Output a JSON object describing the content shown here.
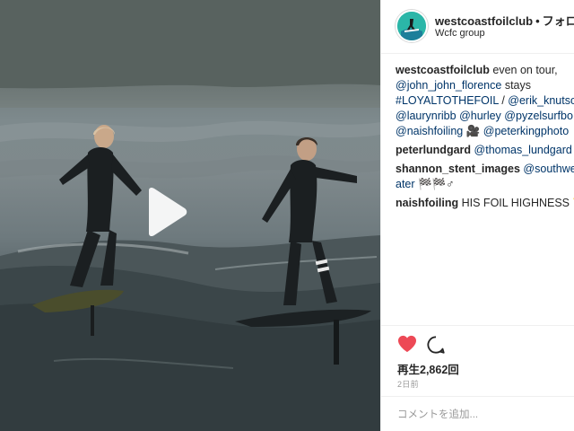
{
  "post": {
    "username": "westcoastfoilclub",
    "separator": "•",
    "follow_label": "フォロー",
    "location": "Wcfc group",
    "views_label": "再生2,862回",
    "timestamp": "2日前",
    "comment_placeholder": "コメントを追加..."
  },
  "comments": [
    {
      "user": "westcoastfoilclub",
      "lines": [
        [
          {
            "t": "text",
            "v": "even on tour,"
          }
        ],
        [
          {
            "t": "mention",
            "v": "@john_john_florence"
          },
          {
            "t": "text",
            "v": " stays"
          }
        ],
        [
          {
            "t": "mention",
            "v": "#LOYALTOTHEFOIL"
          },
          {
            "t": "text",
            "v": " / "
          },
          {
            "t": "mention",
            "v": "@erik_knutson_"
          }
        ],
        [
          {
            "t": "mention",
            "v": "@laurynribb"
          },
          {
            "t": "text",
            "v": " "
          },
          {
            "t": "mention",
            "v": "@hurley"
          },
          {
            "t": "text",
            "v": " "
          },
          {
            "t": "mention",
            "v": "@pyzelsurfbo"
          }
        ],
        [
          {
            "t": "mention",
            "v": "@naishfoiling"
          },
          {
            "t": "text",
            "v": " 🎥 "
          },
          {
            "t": "mention",
            "v": "@peterkingphoto"
          }
        ]
      ]
    },
    {
      "user": "peterlundgard",
      "lines": [
        [
          {
            "t": "mention",
            "v": "@thomas_lundgard"
          }
        ]
      ]
    },
    {
      "user": "shannon_stent_images",
      "lines": [
        [
          {
            "t": "mention",
            "v": "@southwes"
          }
        ],
        [
          {
            "t": "mention",
            "v": "ater"
          },
          {
            "t": "text",
            "v": " 🏁🏁♂"
          }
        ]
      ]
    },
    {
      "user": "naishfoiling",
      "lines": [
        [
          {
            "t": "text",
            "v": "HIS FOIL HIGHNESS 👑"
          }
        ]
      ]
    }
  ],
  "colors": {
    "like_heart": "#ed4956",
    "mention": "#003569",
    "avatar_bg": "#2bb6a8"
  },
  "icons": {
    "play": "play-icon",
    "like": "heart-icon",
    "comment": "comment-icon"
  }
}
